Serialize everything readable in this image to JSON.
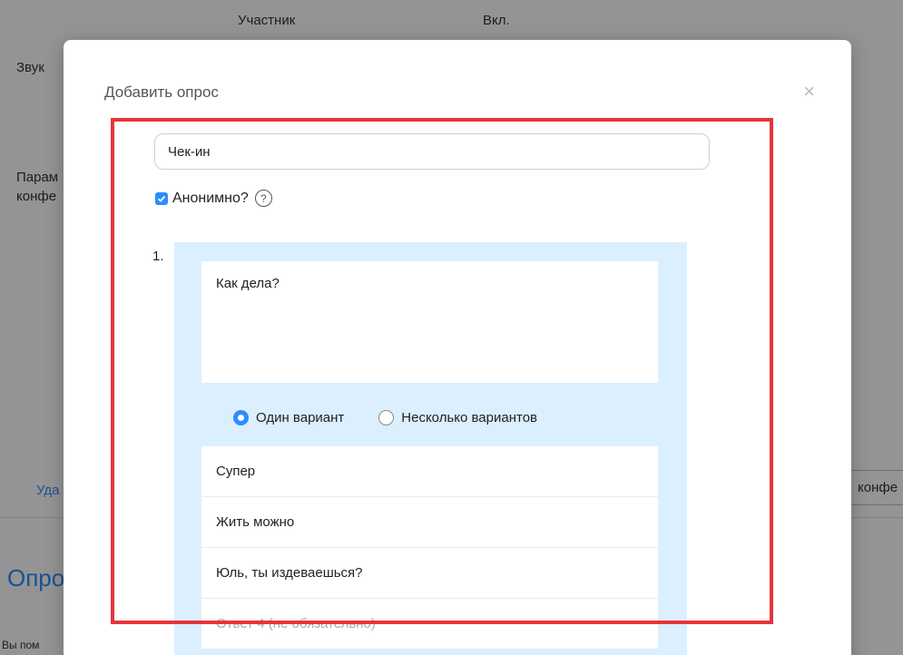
{
  "background": {
    "col_participant": "Участник",
    "col_on": "Вкл.",
    "sound_label": "Звук",
    "params_label_line1": "Парам",
    "params_label_line2": "конфе",
    "delete_link": "Уда",
    "conf_chip": "конфе",
    "polls_heading": "Опро",
    "footer_text": "Вы пом"
  },
  "modal": {
    "title": "Добавить опрос",
    "close_label": "×",
    "poll_title_value": "Чек-ин",
    "anonymous_label": "Анонимно?",
    "help_label": "?",
    "question": {
      "number": "1.",
      "text": "Как дела?",
      "single_choice_label": "Один вариант",
      "multi_choice_label": "Несколько вариантов",
      "selected_mode": "single",
      "answers": [
        "Супер",
        "Жить можно",
        "Юль, ты издеваешься?"
      ],
      "answer4_placeholder": "Ответ 4 (не обязательно)"
    }
  },
  "colors": {
    "accent": "#2d8cff",
    "card_bg": "#dcefff",
    "highlight": "#e8333a"
  }
}
